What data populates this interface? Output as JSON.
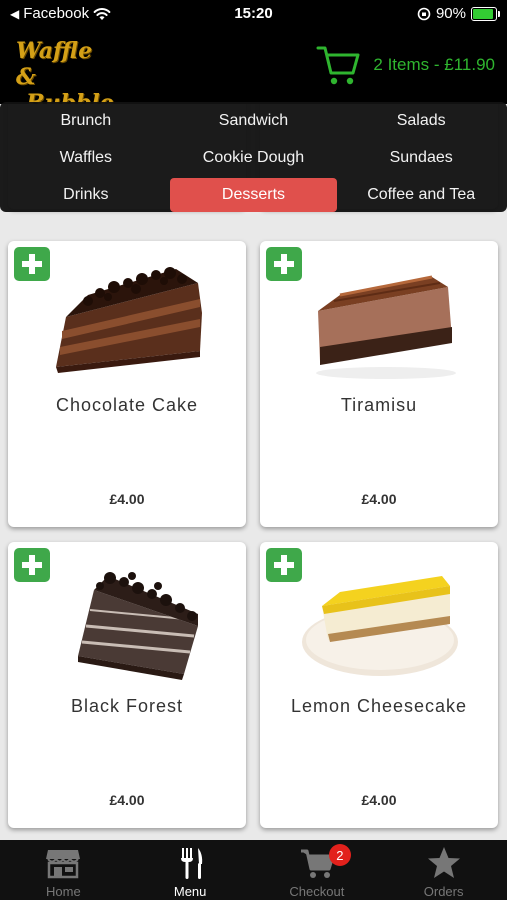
{
  "status_bar": {
    "carrier": "Facebook",
    "time": "15:20",
    "battery": "90%",
    "battery_level": 0.9
  },
  "header": {
    "logo_line1": "Waffle &",
    "logo_line2": "Bubble",
    "cart_summary": "2 Items - £11.90"
  },
  "categories": [
    {
      "label": "Brunch",
      "active": false
    },
    {
      "label": "Sandwich",
      "active": false
    },
    {
      "label": "Salads",
      "active": false
    },
    {
      "label": "Waffles",
      "active": false
    },
    {
      "label": "Cookie Dough",
      "active": false
    },
    {
      "label": "Sundaes",
      "active": false
    },
    {
      "label": "Drinks",
      "active": false
    },
    {
      "label": "Desserts",
      "active": true
    },
    {
      "label": "Coffee and Tea",
      "active": false
    }
  ],
  "products": [
    {
      "name": "Chocolate Cake",
      "price": "£4.00",
      "icon": "chocolate-cake-image"
    },
    {
      "name": "Tiramisu",
      "price": "£4.00",
      "icon": "tiramisu-image"
    },
    {
      "name": "Black Forest",
      "price": "£4.00",
      "icon": "black-forest-image"
    },
    {
      "name": "Lemon Cheesecake",
      "price": "£4.00",
      "icon": "lemon-cheesecake-image"
    }
  ],
  "bottom_nav": {
    "items": [
      {
        "label": "Home",
        "icon": "store-icon",
        "active": false
      },
      {
        "label": "Menu",
        "icon": "cutlery-icon",
        "active": true
      },
      {
        "label": "Checkout",
        "icon": "cart-icon",
        "active": false,
        "badge": "2"
      },
      {
        "label": "Orders",
        "icon": "star-icon",
        "active": false
      }
    ]
  },
  "colors": {
    "accent_red": "#e0504c",
    "cart_green": "#2fb52f",
    "add_green": "#3fa84a",
    "logo_gold": "#d4a017"
  }
}
